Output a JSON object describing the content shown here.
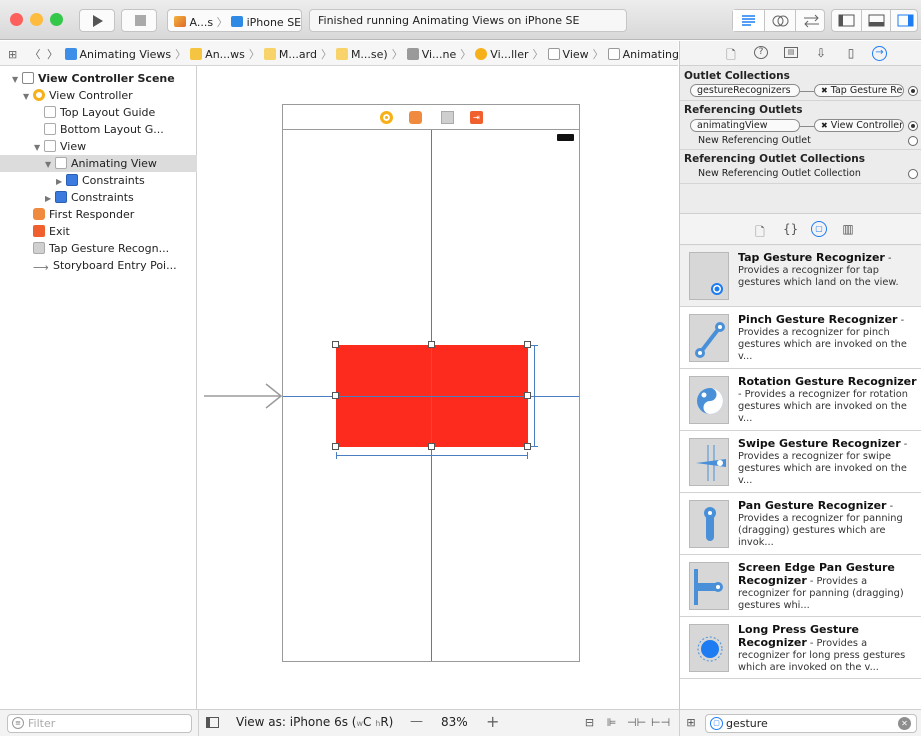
{
  "toolbar": {
    "scheme_target": "A...s",
    "device": "iPhone SE",
    "status": "Finished running Animating Views on iPhone SE",
    "window_lights": [
      "#fc605c",
      "#fdbc40",
      "#34c84a"
    ]
  },
  "jumpbar": {
    "crumbs": [
      {
        "label": "Animating Views",
        "icon": "project-icon"
      },
      {
        "label": "An...ws",
        "icon": "folder-icon"
      },
      {
        "label": "M...ard",
        "icon": "storyboard-icon"
      },
      {
        "label": "M...se)",
        "icon": "storyboard-icon"
      },
      {
        "label": "Vi...ne",
        "icon": "scene-icon"
      },
      {
        "label": "Vi...ller",
        "icon": "view-controller-icon"
      },
      {
        "label": "View",
        "icon": "view-icon"
      },
      {
        "label": "Animating View",
        "icon": "view-icon"
      }
    ]
  },
  "outline": {
    "items": [
      {
        "label": "View Controller Scene",
        "indent": 0,
        "tri": "▼",
        "icon": "scene-icon",
        "bold": true
      },
      {
        "label": "View Controller",
        "indent": 1,
        "tri": "▼",
        "icon": "view-controller-icon"
      },
      {
        "label": "Top Layout Guide",
        "indent": 2,
        "tri": "",
        "icon": "layout-guide-icon"
      },
      {
        "label": "Bottom Layout G...",
        "indent": 2,
        "tri": "",
        "icon": "layout-guide-icon"
      },
      {
        "label": "View",
        "indent": 2,
        "tri": "▼",
        "icon": "view-icon"
      },
      {
        "label": "Animating View",
        "indent": 3,
        "tri": "▼",
        "icon": "view-icon",
        "selected": true
      },
      {
        "label": "Constraints",
        "indent": 4,
        "tri": "▶",
        "icon": "constraints-icon"
      },
      {
        "label": "Constraints",
        "indent": 3,
        "tri": "▶",
        "icon": "constraints-icon"
      },
      {
        "label": "First Responder",
        "indent": 1,
        "tri": "",
        "icon": "first-responder-icon"
      },
      {
        "label": "Exit",
        "indent": 1,
        "tri": "",
        "icon": "exit-icon"
      },
      {
        "label": "Tap Gesture Recogn...",
        "indent": 1,
        "tri": "",
        "icon": "tap-gesture-icon"
      },
      {
        "label": "Storyboard Entry Poi...",
        "indent": 1,
        "tri": "",
        "icon": "entry-arrow-icon"
      }
    ]
  },
  "connections": {
    "outlet_collections_title": "Outlet Collections",
    "outlet_collection": {
      "name": "gestureRecognizers",
      "target": "Tap Gesture Re..."
    },
    "referencing_outlets_title": "Referencing Outlets",
    "referencing_outlet": {
      "name": "animatingView",
      "target": "View Controller"
    },
    "new_referencing_outlet": "New Referencing Outlet",
    "referencing_collections_title": "Referencing Outlet Collections",
    "new_referencing_collection": "New Referencing Outlet Collection"
  },
  "library": {
    "items": [
      {
        "title": "Tap Gesture Recognizer",
        "desc": "Provides a recognizer for tap gestures which land on the view.",
        "icon": "tap-gesture-icon"
      },
      {
        "title": "Pinch Gesture Recognizer",
        "desc": "Provides a recognizer for pinch gestures which are invoked on the v...",
        "icon": "pinch-gesture-icon"
      },
      {
        "title": "Rotation Gesture Recognizer",
        "desc": "Provides a recognizer for rotation gestures which are invoked on the v...",
        "icon": "rotation-gesture-icon"
      },
      {
        "title": "Swipe Gesture Recognizer",
        "desc": "Provides a recognizer for swipe gestures which are invoked on the v...",
        "icon": "swipe-gesture-icon"
      },
      {
        "title": "Pan Gesture Recognizer",
        "desc": "Provides a recognizer for panning (dragging) gestures which are invok...",
        "icon": "pan-gesture-icon"
      },
      {
        "title": "Screen Edge Pan Gesture Recognizer",
        "desc": "Provides a recognizer for panning (dragging) gestures whi...",
        "icon": "screen-edge-pan-icon"
      },
      {
        "title": "Long Press Gesture Recognizer",
        "desc": "Provides a recognizer for long press gestures which are invoked on the v...",
        "icon": "long-press-gesture-icon"
      }
    ]
  },
  "bottombar": {
    "filter_placeholder": "Filter",
    "view_as": "View as: iPhone 6s (",
    "size_class_w": "w",
    "size_class_wv": "C",
    "size_class_h": "h",
    "size_class_hv": "R)",
    "zoom_minus": "—",
    "zoom": "83%",
    "zoom_plus": "+",
    "search_value": "gesture"
  },
  "colors": {
    "accent": "#1e7cf2",
    "animating_view": "#fc2b1e",
    "constraint_line": "#4a7ec0"
  }
}
